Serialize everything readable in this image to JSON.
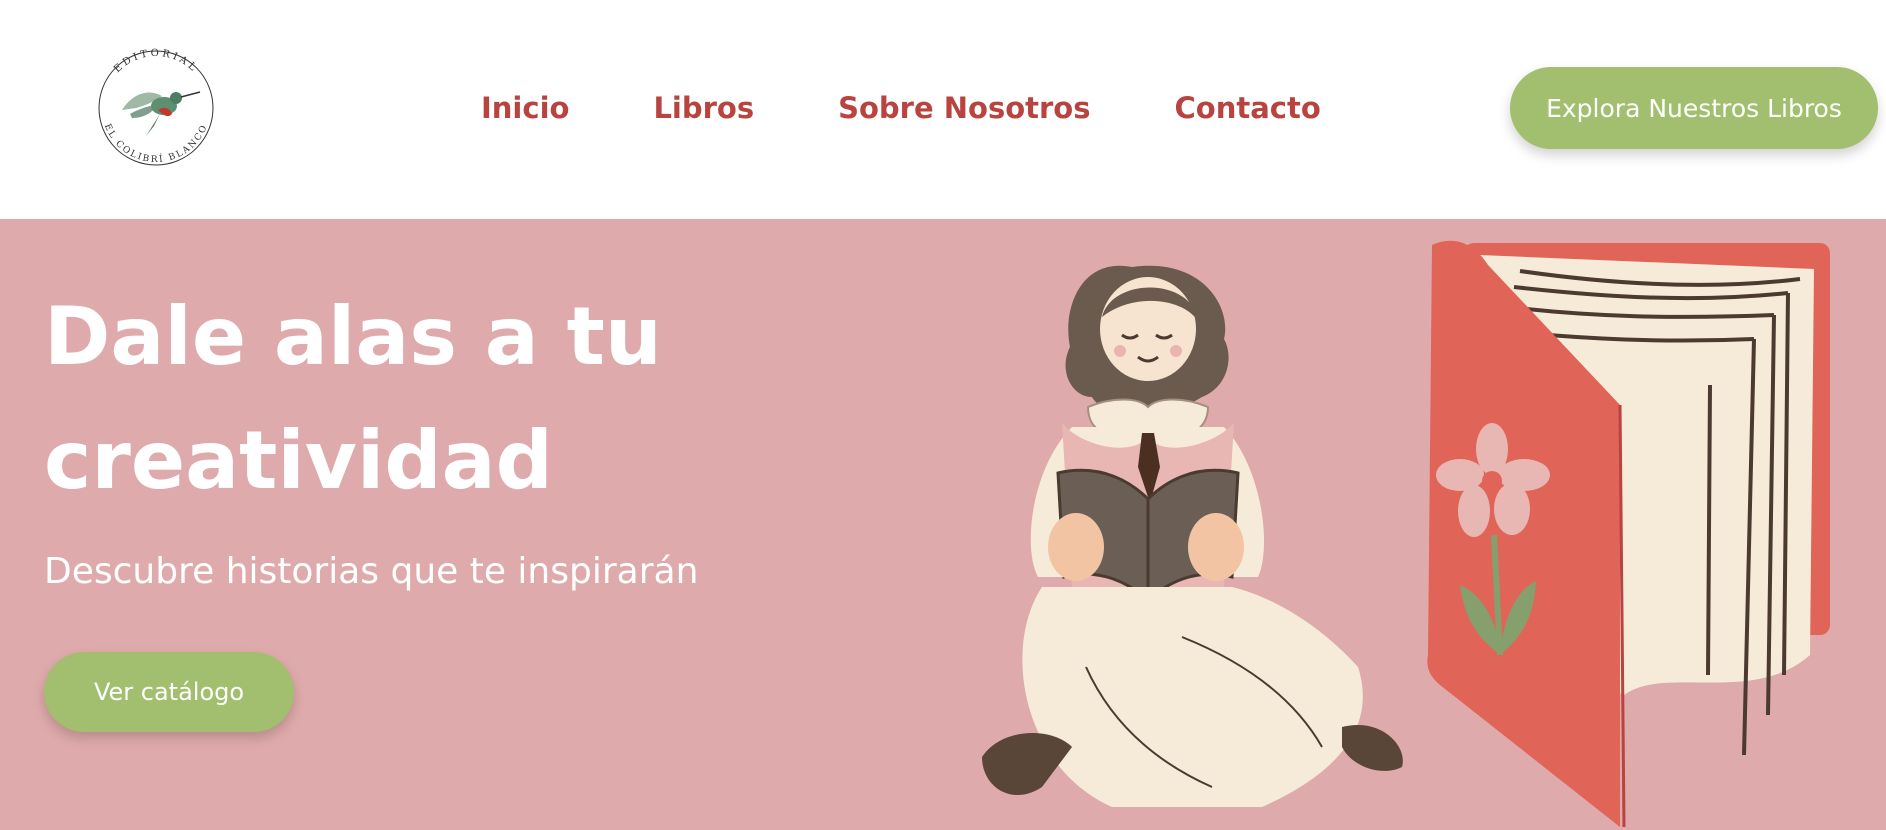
{
  "brand": {
    "logo_top_text": "EDITORIAL",
    "logo_bottom_text": "EL COLIBRÍ BLANCO"
  },
  "nav": {
    "items": [
      {
        "label": "Inicio"
      },
      {
        "label": "Libros"
      },
      {
        "label": "Sobre Nosotros"
      },
      {
        "label": "Contacto"
      }
    ]
  },
  "header_cta": {
    "label": "Explora Nuestros Libros"
  },
  "hero": {
    "title_line1": "Dale alas a tu",
    "title_line2": "creatividad",
    "subtitle": "Descubre historias que te inspirarán",
    "button_label": "Ver catálogo"
  },
  "colors": {
    "accent_red": "#b9433f",
    "button_green": "#a1bf6e",
    "hero_pink": "#dfaaab",
    "book_red": "#e06558"
  },
  "icons": {
    "logo": "hummingbird-logo",
    "illustration_left": "girl-reading-illustration",
    "illustration_right": "open-book-flower-illustration"
  }
}
